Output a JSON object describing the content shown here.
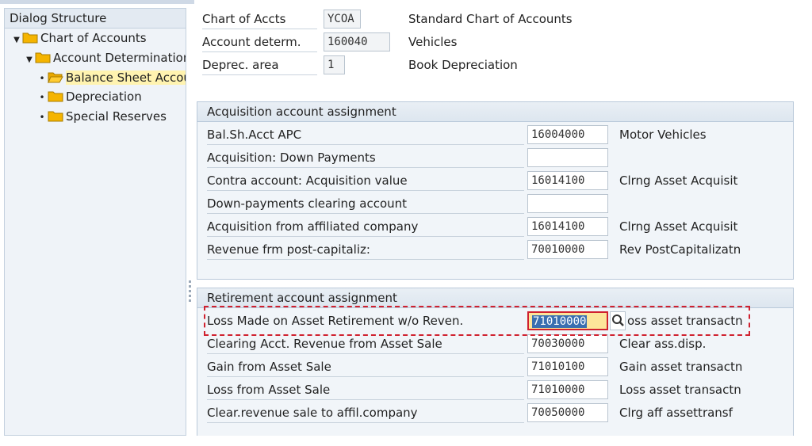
{
  "dialog_structure": {
    "title": "Dialog Structure",
    "nodes": [
      {
        "label": "Chart of Accounts",
        "icon": "folder-icon",
        "expand": "expanded-arrow"
      },
      {
        "label": "Account Determination",
        "icon": "folder-icon",
        "expand": "expanded-arrow"
      },
      {
        "label": "Balance Sheet Accou",
        "icon": "open-folder-icon",
        "selected": true
      },
      {
        "label": "Depreciation",
        "icon": "folder-icon"
      },
      {
        "label": "Special Reserves",
        "icon": "folder-icon"
      }
    ]
  },
  "header": {
    "chart_of_accts": {
      "label": "Chart of Accts",
      "value": "YCOA",
      "desc": "Standard Chart of Accounts"
    },
    "account_determ": {
      "label": "Account determ.",
      "value": "160040",
      "desc": "Vehicles"
    },
    "deprec_area": {
      "label": "Deprec. area",
      "value": "1",
      "desc": "Book Depreciation"
    }
  },
  "acquisition": {
    "title": "Acquisition account assignment",
    "rows": [
      {
        "label": "Bal.Sh.Acct APC",
        "value": "16004000",
        "desc": "Motor Vehicles"
      },
      {
        "label": "Acquisition: Down Payments",
        "value": "",
        "desc": ""
      },
      {
        "label": "Contra account: Acquisition value",
        "value": "16014100",
        "desc": "Clrng Asset Acquisit"
      },
      {
        "label": "Down-payments clearing account",
        "value": "",
        "desc": ""
      },
      {
        "label": "Acquisition from affiliated company",
        "value": "16014100",
        "desc": "Clrng Asset Acquisit"
      },
      {
        "label": "Revenue frm post-capitaliz:",
        "value": "70010000",
        "desc": "Rev PostCapitalizatn"
      }
    ]
  },
  "retirement": {
    "title": "Retirement account assignment",
    "rows": [
      {
        "label": "Loss Made on Asset Retirement w/o Reven.",
        "value": "71010000",
        "desc": "oss asset transactn"
      },
      {
        "label": "Clearing Acct. Revenue from Asset Sale",
        "value": "70030000",
        "desc": "Clear ass.disp."
      },
      {
        "label": "Gain from Asset Sale",
        "value": "71010100",
        "desc": "Gain asset transactn"
      },
      {
        "label": "Loss from Asset Sale",
        "value": "71010000",
        "desc": "Loss asset transactn"
      },
      {
        "label": "Clear.revenue sale to affil.company",
        "value": "70050000",
        "desc": "Clrg aff assettransf"
      }
    ],
    "search_help_icon": "magnifier-icon"
  },
  "colors": {
    "highlight": "#d0212f",
    "folder": "#f5b400",
    "selection": "#fff3b0"
  }
}
